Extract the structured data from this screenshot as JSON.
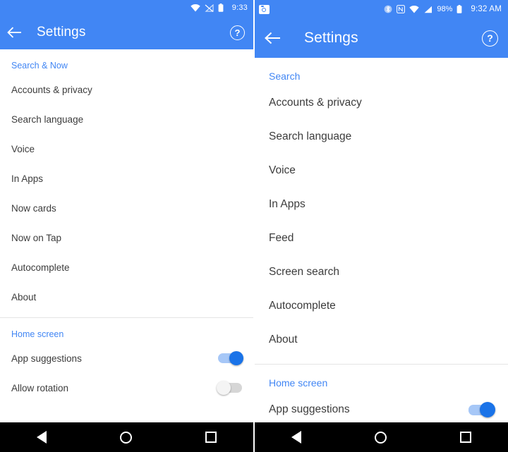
{
  "left": {
    "status": {
      "time": "9:33",
      "icons": [
        "wifi-icon",
        "signal-off-icon",
        "battery-icon"
      ]
    },
    "appbar": {
      "back_icon": "arrow-back-icon",
      "title": "Settings",
      "help_label": "?"
    },
    "sections": [
      {
        "header": "Search & Now",
        "items": [
          {
            "label": "Accounts & privacy",
            "control": "none"
          },
          {
            "label": "Search language",
            "control": "none"
          },
          {
            "label": "Voice",
            "control": "none"
          },
          {
            "label": "In Apps",
            "control": "none"
          },
          {
            "label": "Now cards",
            "control": "none"
          },
          {
            "label": "Now on Tap",
            "control": "none"
          },
          {
            "label": "Autocomplete",
            "control": "none"
          },
          {
            "label": "About",
            "control": "none"
          }
        ]
      },
      {
        "header": "Home screen",
        "items": [
          {
            "label": "App suggestions",
            "control": "switch",
            "state": "on"
          },
          {
            "label": "Allow rotation",
            "control": "switch",
            "state": "off"
          }
        ]
      }
    ],
    "navbar": {
      "back": "nav-back-icon",
      "home": "nav-home-icon",
      "recents": "nav-recents-icon"
    }
  },
  "right": {
    "status": {
      "notification_icon": "camera-notification-icon",
      "time": "9:32 AM",
      "battery_percent": "98%",
      "icons": [
        "bluetooth-icon",
        "nfc-icon",
        "wifi-icon",
        "signal-icon",
        "battery-icon"
      ]
    },
    "appbar": {
      "back_icon": "arrow-back-icon",
      "title": "Settings",
      "help_label": "?"
    },
    "sections": [
      {
        "header": "Search",
        "items": [
          {
            "label": "Accounts & privacy",
            "control": "none"
          },
          {
            "label": "Search language",
            "control": "none"
          },
          {
            "label": "Voice",
            "control": "none"
          },
          {
            "label": "In Apps",
            "control": "none"
          },
          {
            "label": "Feed",
            "control": "none"
          },
          {
            "label": "Screen search",
            "control": "none"
          },
          {
            "label": "Autocomplete",
            "control": "none"
          },
          {
            "label": "About",
            "control": "none"
          }
        ]
      },
      {
        "header": "Home screen",
        "items": [
          {
            "label": "App suggestions",
            "control": "switch",
            "state": "on"
          }
        ]
      }
    ],
    "navbar": {
      "back": "nav-back-icon",
      "home": "nav-home-icon",
      "recents": "nav-recents-icon"
    }
  },
  "colors": {
    "accent": "#4186f4",
    "toggle_on": "#1a73e8",
    "toggle_off": "#d6d6d6",
    "text": "#3c3c3c",
    "divider": "#e4e4e4"
  }
}
